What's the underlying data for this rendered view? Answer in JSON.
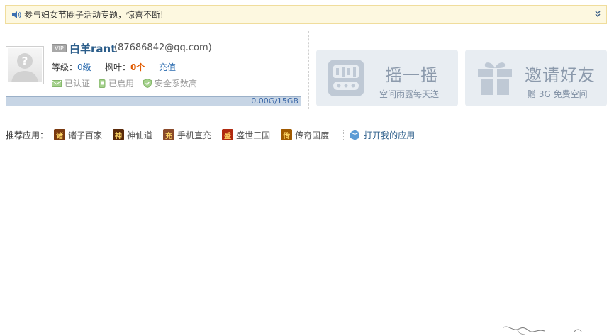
{
  "notice": {
    "icon": "speaker-icon",
    "text": "参与妇女节圈子活动专题，惊喜不断!"
  },
  "profile": {
    "vip_badge": "VIP",
    "name": "白羊rant",
    "email": "(87686842@qq.com)",
    "level_label": "等级：",
    "level_value": "0级",
    "maple_label": "枫叶：",
    "maple_value": "0个",
    "recharge": "充值",
    "status": [
      "已认证",
      "已启用",
      "安全系数高"
    ]
  },
  "storage": {
    "text": "0.00G/15GB",
    "used_fraction": 0.0
  },
  "cards": [
    {
      "title": "摇一摇",
      "subtitle": "空间雨露每天送",
      "icon": "shake-icon"
    },
    {
      "title": "邀请好友",
      "subtitle": "赠 3G 免费空间",
      "icon": "gift-icon"
    }
  ],
  "recommend": {
    "label": "推荐应用：",
    "apps": [
      {
        "label": "诸子百家",
        "icon_char": "诸",
        "color": "#7a3a10"
      },
      {
        "label": "神仙道",
        "icon_char": "神",
        "color": "#5a2a0a"
      },
      {
        "label": "手机直充",
        "icon_char": "充",
        "color": "#8a4a2a"
      },
      {
        "label": "盛世三国",
        "icon_char": "盛",
        "color": "#b02a10"
      },
      {
        "label": "传奇国度",
        "icon_char": "传",
        "color": "#a05a00"
      }
    ],
    "my_apps": "打开我的应用"
  },
  "colors": {
    "accent": "#2b5d8a",
    "notice_bg": "#fdf8e0",
    "card_bg": "#e8edf2",
    "maple": "#e05a00"
  }
}
